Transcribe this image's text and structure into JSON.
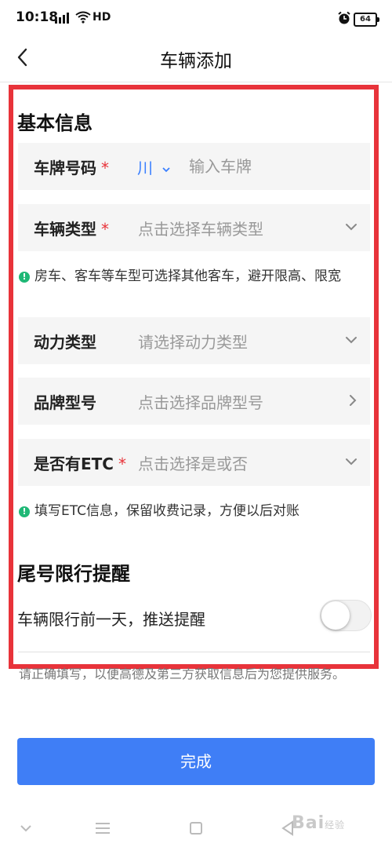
{
  "status_bar": {
    "time": "10:18",
    "network_type": "HD",
    "battery": "64"
  },
  "header": {
    "title": "车辆添加"
  },
  "basic_info": {
    "title": "基本信息",
    "plate": {
      "label": "车牌号码",
      "required_mark": "*",
      "province": "川",
      "placeholder": "输入车牌"
    },
    "vehicle_type": {
      "label": "车辆类型",
      "required_mark": "*",
      "placeholder": "点击选择车辆类型"
    },
    "vehicle_type_tip": "房车、客车等车型可选择其他客车，避开限高、限宽",
    "power_type": {
      "label": "动力类型",
      "placeholder": "请选择动力类型"
    },
    "brand_model": {
      "label": "品牌型号",
      "placeholder": "点击选择品牌型号"
    },
    "etc": {
      "label": "是否有ETC",
      "required_mark": "*",
      "placeholder": "点击选择是或否"
    },
    "etc_tip": "填写ETC信息，保留收费记录，方便以后对账"
  },
  "restriction": {
    "title": "尾号限行提醒",
    "remind_text": "车辆限行前一天，推送提醒",
    "remind_enabled": false
  },
  "note": "请正确填写，以便高德及第三方获取信息后为您提供服务。",
  "done_button": "完成",
  "watermark": {
    "text": "Bai",
    "suffix": "经验"
  },
  "colors": {
    "accent": "#3f7ef6",
    "required": "#e8333a",
    "tip_icon": "#1fb876",
    "highlight_frame": "#e8333a"
  }
}
